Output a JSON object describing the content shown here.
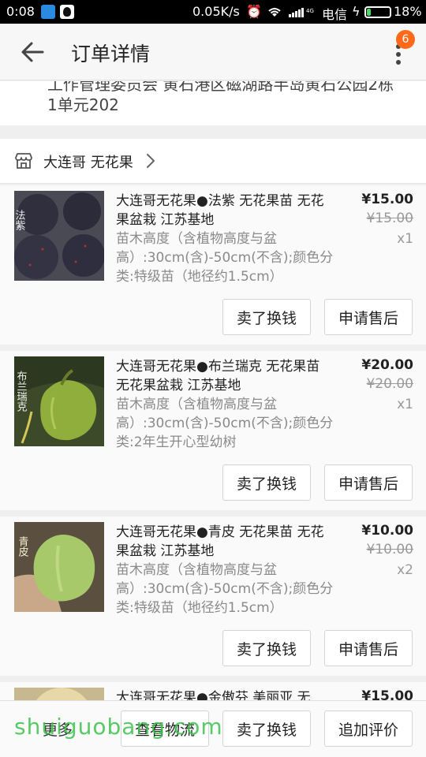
{
  "status_bar": {
    "time": "0:08",
    "net_speed": "0.05K/s",
    "carrier": "电信",
    "battery_pct": "18%",
    "battery_level": 0.18
  },
  "header": {
    "title": "订单详情",
    "badge_count": "6"
  },
  "address": {
    "line1_cut": "工作管理委员会 黄石港区磁湖路半岛黄石公园2栋",
    "line2": "1单元202"
  },
  "shop": {
    "name": "大连哥 无花果"
  },
  "items": [
    {
      "name": "大连哥无花果●法紫 无花果苗 无花果盆栽 江苏基地",
      "spec": "苗木高度（含植物高度与盆高）:30cm(含)-50cm(不含);颜色分类:特级苗（地径约1.5cm）",
      "price": "¥15.00",
      "orig_price": "¥15.00",
      "qty": "x1",
      "thumb_label": "法紫",
      "sell_label": "卖了换钱",
      "aftersale_label": "申请售后"
    },
    {
      "name": "大连哥无花果●布兰瑞克 无花果苗 无花果盆栽 江苏基地",
      "spec": "苗木高度（含植物高度与盆高）:30cm(含)-50cm(不含);颜色分类:2年生开心型幼树",
      "price": "¥20.00",
      "orig_price": "¥20.00",
      "qty": "x1",
      "thumb_label": "布兰瑞克",
      "sell_label": "卖了换钱",
      "aftersale_label": "申请售后"
    },
    {
      "name": "大连哥无花果●青皮 无花果苗 无花果盆栽 江苏基地",
      "spec": "苗木高度（含植物高度与盆高）:30cm(含)-50cm(不含);颜色分类:特级苗（地径约1.5cm）",
      "price": "¥10.00",
      "orig_price": "¥10.00",
      "qty": "x2",
      "thumb_label": "青皮",
      "sell_label": "卖了换钱",
      "aftersale_label": "申请售后"
    },
    {
      "name": "大连哥无花果●金傲芬 美丽亚 无",
      "price": "¥15.00"
    }
  ],
  "bottom_bar": {
    "more": "更多",
    "logistics": "查看物流",
    "sell": "卖了换钱",
    "review": "追加评价"
  },
  "watermark": "shuiguobang.com",
  "colors": {
    "accent_badge": "#ff6a1a",
    "watermark": "#3cc24c",
    "battery": "#4cd964"
  }
}
